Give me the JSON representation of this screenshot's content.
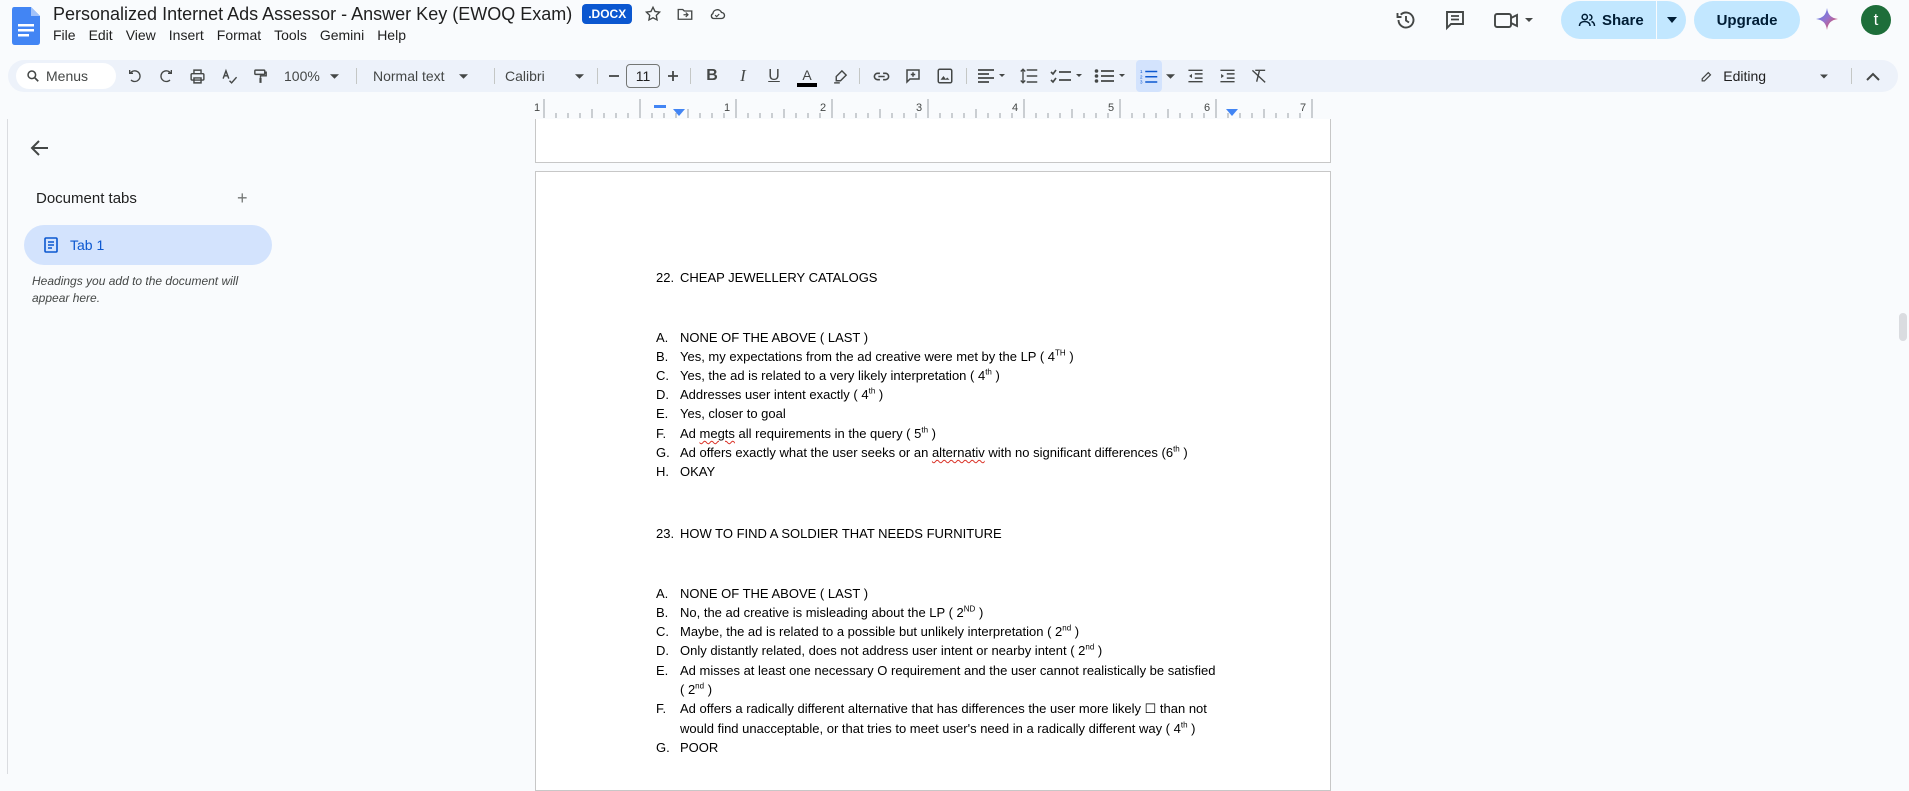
{
  "header": {
    "title": "Personalized Internet Ads Assessor - Answer Key (EWOQ Exam)",
    "badge": ".DOCX",
    "share_label": "Share",
    "upgrade_label": "Upgrade",
    "avatar_letter": "t"
  },
  "menu": [
    "File",
    "Edit",
    "View",
    "Insert",
    "Format",
    "Tools",
    "Gemini",
    "Help"
  ],
  "toolbar": {
    "search_label": "Menus",
    "zoom": "100%",
    "style": "Normal text",
    "font": "Calibri",
    "font_size": "11",
    "mode": "Editing"
  },
  "ruler": {
    "numbers": [
      "1",
      "1",
      "2",
      "3",
      "4",
      "5",
      "6",
      "7"
    ]
  },
  "sidebar": {
    "title": "Document tabs",
    "tab_label": "Tab 1",
    "hint": "Headings you add to the document will appear here."
  },
  "document": {
    "q22": {
      "number": "22.",
      "heading": "CHEAP JEWELLERY CATALOGS",
      "options": [
        {
          "letter": "A.",
          "text": "NONE OF THE ABOVE  ( LAST )"
        },
        {
          "letter": "B.",
          "text": "Yes, my expectations from the ad creative were met by the LP ( 4",
          "sup": "TH",
          "tail": " )"
        },
        {
          "letter": "C.",
          "text": "Yes, the ad is related to a very likely interpretation ( 4",
          "sup": "th",
          "tail": " )"
        },
        {
          "letter": "D.",
          "text": "Addresses user intent exactly ( 4",
          "sup": "th",
          "tail": " )"
        },
        {
          "letter": "E.",
          "text": "Yes, closer to goal"
        },
        {
          "letter": "F.",
          "pre": "Ad ",
          "squig": "megts",
          "text": " all requirements in the query ( 5",
          "sup": "th",
          "tail": " )"
        },
        {
          "letter": "G.",
          "pre": "Ad offers exactly what the user seeks or an ",
          "squig": "alternativ",
          "text": " with no significant differences (6",
          "sup": "th",
          "tail": " )"
        },
        {
          "letter": "H.",
          "text": "OKAY"
        }
      ]
    },
    "q23": {
      "number": "23.",
      "heading": "HOW TO FIND A SOLDIER THAT NEEDS FURNITURE",
      "options": [
        {
          "letter": "A.",
          "text": "NONE OF THE ABOVE  ( LAST )"
        },
        {
          "letter": "B.",
          "text": "No, the ad creative is misleading about the LP ( 2",
          "sup": "ND",
          "tail": " )"
        },
        {
          "letter": "C.",
          "text": "Maybe, the ad is related to a possible but unlikely interpretation ( 2",
          "sup": "nd",
          "tail": " )"
        },
        {
          "letter": "D.",
          "text": "Only distantly related, does not address user intent or nearby intent ( 2",
          "sup": "nd",
          "tail": " )"
        },
        {
          "letter": "E.",
          "text": "Ad misses at least one necessary O requirement and the user cannot realistically be satisfied",
          "text2": "( 2",
          "sup": "nd",
          "tail": " )"
        },
        {
          "letter": "F.",
          "text": "Ad offers a radically different alternative that has differences the user more likely ☐ than not",
          "text2": "would find unacceptable, or that tries to meet user's need in a radically different way ( 4",
          "sup": "th",
          "tail": " )"
        },
        {
          "letter": "G.",
          "text": "POOR"
        }
      ]
    }
  }
}
